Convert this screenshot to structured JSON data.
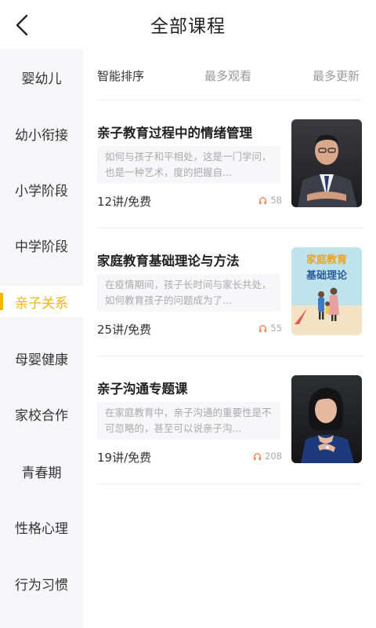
{
  "header": {
    "title": "全部课程"
  },
  "categories": [
    {
      "label": "婴幼儿",
      "active": false
    },
    {
      "label": "幼小衔接",
      "active": false
    },
    {
      "label": "小学阶段",
      "active": false
    },
    {
      "label": "中学阶段",
      "active": false
    },
    {
      "label": "亲子关系",
      "active": true
    },
    {
      "label": "母婴健康",
      "active": false
    },
    {
      "label": "家校合作",
      "active": false
    },
    {
      "label": "青春期",
      "active": false
    },
    {
      "label": "性格心理",
      "active": false
    },
    {
      "label": "行为习惯",
      "active": false
    }
  ],
  "sort": {
    "options": [
      "智能排序",
      "最多观看",
      "最多更新"
    ],
    "active": "智能排序"
  },
  "courses": [
    {
      "title": "亲子教育过程中的情绪管理",
      "desc": "如何与孩子和平相处，这是一门学问，也是一种艺术，度的把握自...",
      "meta": "12讲/免费",
      "views": "58",
      "thumb": "portrait-man"
    },
    {
      "title": "家庭教育基础理论与方法",
      "desc": "在疫情期间，孩子长时间与家长共处，如何教育孩子的问题成为了...",
      "meta": "25讲/免费",
      "views": "55",
      "thumb": "illustration-family",
      "thumb_text": [
        "家庭教育",
        "基础理论"
      ]
    },
    {
      "title": "亲子沟通专题课",
      "desc": "在家庭教育中，亲子沟通的重要性是不可忽略的，甚至可以说亲子沟...",
      "meta": "19讲/免费",
      "views": "208",
      "thumb": "portrait-woman"
    }
  ],
  "colors": {
    "accent": "#f7b500",
    "headphone": "#f08a5d"
  }
}
